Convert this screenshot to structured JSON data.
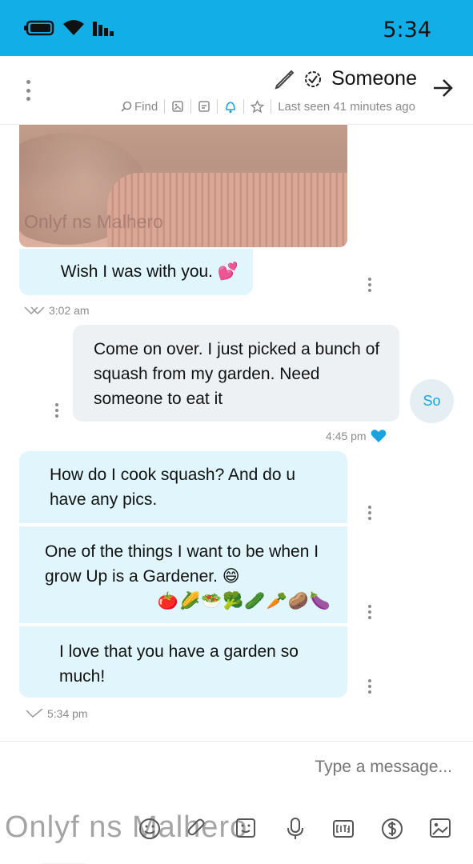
{
  "status_bar": {
    "time": "5:34"
  },
  "header": {
    "contact_name": "Someone",
    "last_seen": "Last seen 41 minutes ago",
    "find_label": "Find"
  },
  "photo": {
    "watermark": "Onlyf ns Malhero"
  },
  "messages": [
    {
      "id": "m1",
      "direction": "incoming",
      "text": "Wish I was with you. 💕",
      "time": "3:02 am"
    },
    {
      "id": "m2",
      "direction": "outgoing",
      "sender_initials": "So",
      "text": "Come on over. I just picked a bunch of squash from my garden. Need someone to eat it",
      "time": "4:45 pm",
      "reaction": "heart"
    },
    {
      "id": "m3",
      "direction": "incoming",
      "text": "How do I cook squash? And do u have any pics."
    },
    {
      "id": "m4",
      "direction": "incoming",
      "text": "One of the things I want to be when I grow Up is a Gardener. 😄",
      "emoji_line": "🍅🌽🥗🥦🥒🥕🥔🍆"
    },
    {
      "id": "m5",
      "direction": "incoming",
      "text": "I love that you have a garden so much!",
      "time": "5:34 pm"
    }
  ],
  "composer": {
    "placeholder": "Type a message...",
    "watermark": "Onlyf ns Malhero"
  },
  "colors": {
    "accent": "#12aee8",
    "incoming_bubble": "#e0f6fc",
    "outgoing_bubble": "#eef1f3",
    "heart": "#1aa3de"
  }
}
